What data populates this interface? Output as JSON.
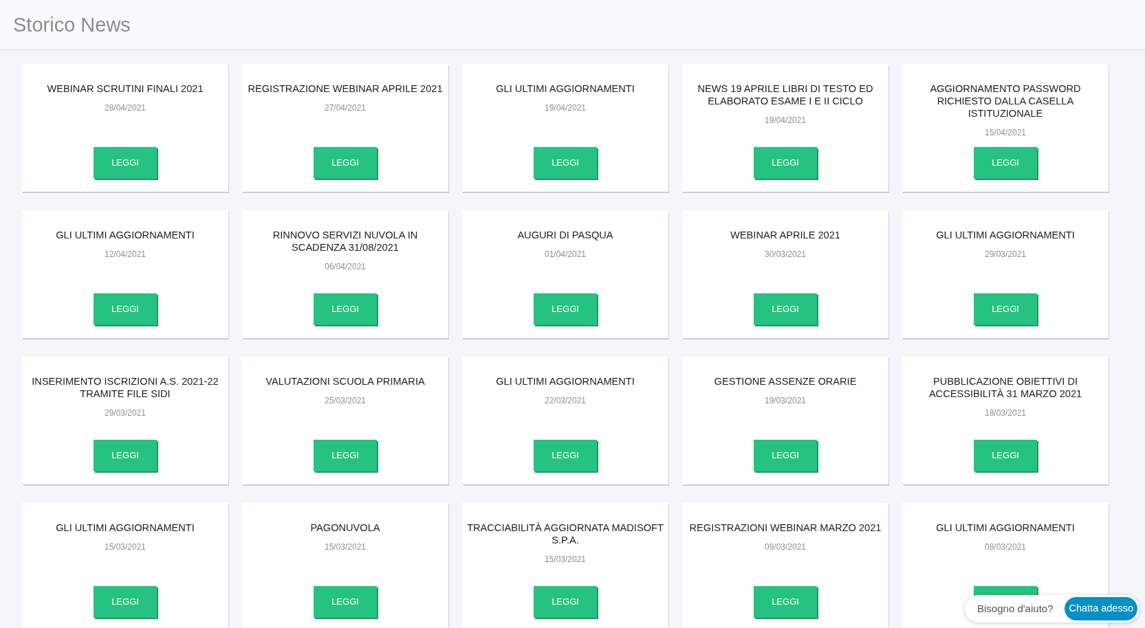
{
  "page_title": "Storico News",
  "news": [
    {
      "title": "WEBINAR SCRUTINI FINALI 2021",
      "date": "28/04/2021",
      "button_label": "LEGGI"
    },
    {
      "title": "REGISTRAZIONE WEBINAR APRILE 2021",
      "date": "27/04/2021",
      "button_label": "LEGGI"
    },
    {
      "title": "GLI ULTIMI AGGIORNAMENTI",
      "date": "19/04/2021",
      "button_label": "LEGGI"
    },
    {
      "title": "NEWS 19 APRILE LIBRI DI TESTO ED ELABORATO ESAME I E II CICLO",
      "date": "19/04/2021",
      "button_label": "LEGGI"
    },
    {
      "title": "AGGIORNAMENTO PASSWORD RICHIESTO DALLA CASELLA ISTITUZIONALE",
      "date": "15/04/2021",
      "button_label": "LEGGI"
    },
    {
      "title": "GLI ULTIMI AGGIORNAMENTI",
      "date": "12/04/2021",
      "button_label": "LEGGI"
    },
    {
      "title": "RINNOVO SERVIZI NUVOLA IN SCADENZA 31/08/2021",
      "date": "06/04/2021",
      "button_label": "LEGGI"
    },
    {
      "title": "AUGURI DI PASQUA",
      "date": "01/04/2021",
      "button_label": "LEGGI"
    },
    {
      "title": "WEBINAR APRILE 2021",
      "date": "30/03/2021",
      "button_label": "LEGGI"
    },
    {
      "title": "GLI ULTIMI AGGIORNAMENTI",
      "date": "29/03/2021",
      "button_label": "LEGGI"
    },
    {
      "title": "INSERIMENTO ISCRIZIONI A.S. 2021-22 TRAMITE FILE SIDI",
      "date": "29/03/2021",
      "button_label": "LEGGI"
    },
    {
      "title": "VALUTAZIONI SCUOLA PRIMARIA",
      "date": "25/03/2021",
      "button_label": "LEGGI"
    },
    {
      "title": "GLI ULTIMI AGGIORNAMENTI",
      "date": "22/03/2021",
      "button_label": "LEGGI"
    },
    {
      "title": "GESTIONE ASSENZE ORARIE",
      "date": "19/03/2021",
      "button_label": "LEGGI"
    },
    {
      "title": "PUBBLICAZIONE OBIETTIVI DI ACCESSIBILITÀ 31 MARZO 2021",
      "date": "18/03/2021",
      "button_label": "LEGGI"
    },
    {
      "title": "GLI ULTIMI AGGIORNAMENTI",
      "date": "15/03/2021",
      "button_label": "LEGGI"
    },
    {
      "title": "PAGONUVOLA",
      "date": "15/03/2021",
      "button_label": "LEGGI"
    },
    {
      "title": "TRACCIABILITÀ AGGIORNATA MADISOFT S.P.A.",
      "date": "15/03/2021",
      "button_label": "LEGGI"
    },
    {
      "title": "REGISTRAZIONI WEBINAR MARZO 2021",
      "date": "09/03/2021",
      "button_label": "LEGGI"
    },
    {
      "title": "GLI ULTIMI AGGIORNAMENTI",
      "date": "08/03/2021"
    }
  ],
  "chat_widget": {
    "prompt": "Bisogno d'aiuto?",
    "button_label": "Chatta adesso"
  }
}
